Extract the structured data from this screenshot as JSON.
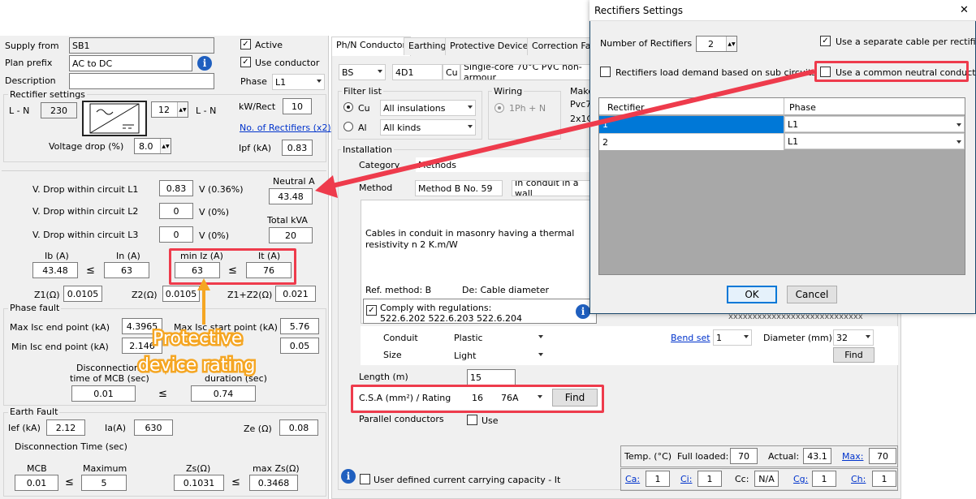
{
  "left": {
    "supply_from_label": "Supply from",
    "supply_from": "SB1",
    "plan_prefix_label": "Plan prefix",
    "plan_prefix": "AC to DC",
    "description_label": "Description",
    "description": "",
    "active_label": "Active",
    "use_conductor_label": "Use conductor",
    "phase_label": "Phase",
    "phase": "L1",
    "rect_group": "Rectifier settings",
    "ln_label": "L - N",
    "ln_value": "230",
    "ln_out_label": "L - N",
    "rect_count": "12",
    "kw_rect_label": "kW/Rect",
    "kw_rect": "10",
    "num_rect_link": "No. of Rectifiers (x2)",
    "vdrop_label": "Voltage drop (%)",
    "vdrop": "8.0",
    "ipf_label": "Ipf (kA)",
    "ipf": "0.83",
    "vdl1_label": "V. Drop within circuit L1",
    "vdl1": "0.83",
    "vdl1_unit": "V (0.36%)",
    "vdl2_label": "V. Drop within circuit L2",
    "vdl2": "0",
    "vdl2_unit": "V (0%)",
    "vdl3_label": "V. Drop within circuit L3",
    "vdl3": "0",
    "vdl3_unit": "V (0%)",
    "neutral_label": "Neutral A",
    "neutral": "43.48",
    "total_kva_label": "Total kVA",
    "total_kva": "20",
    "ib_label": "Ib (A)",
    "ib": "43.48",
    "in_label": "In (A)",
    "in": "63",
    "miniz_label": "min Iz (A)",
    "miniz": "63",
    "it_label": "It (A)",
    "it": "76",
    "z1_label": "Z1(Ω)",
    "z1": "0.0105",
    "z2_label": "Z2(Ω)",
    "z2": "0.0105",
    "z12_label": "Z1+Z2(Ω)",
    "z12": "0.021",
    "phase_fault": "Phase fault",
    "max_isc_label": "Max Isc end point (kA)",
    "max_isc": "4.3965",
    "max_isc_start_label": "Max Isc start point (kA)",
    "max_isc_start": "5.76",
    "min_isc_label": "Min Isc end point (kA)",
    "min_isc": "2.146",
    "min_isc_start": "0.05",
    "disc_label1": "Disconnection",
    "disc_label2": "time of MCB (sec)",
    "disc_mcb": "0.01",
    "duration_label": "duration (sec)",
    "duration": "0.74",
    "earth_fault": "Earth Fault",
    "ief_label": "Ief (kA)",
    "ief": "2.12",
    "ia_label": "Ia(A)",
    "ia": "630",
    "ze_label": "Ze (Ω)",
    "ze": "0.08",
    "disc_time_label": "Disconnection Time (sec)",
    "mcb_label": "MCB",
    "mcb": "0.01",
    "maximum_label": "Maximum",
    "maximum": "5",
    "zs_label": "Zs(Ω)",
    "zs": "0.1031",
    "maxzs_label": "max Zs(Ω)",
    "maxzs": "0.3468",
    "le": "≤"
  },
  "annotation": {
    "line1": "Protective",
    "line2": "device rating"
  },
  "tabs": [
    "Ph/N Conductor",
    "Earthing",
    "Protective Devices",
    "Correction Fact"
  ],
  "center": {
    "std": "BS",
    "code": "4D1",
    "mat": "Cu",
    "cable": "Single-core 70°C PVC non-armour",
    "filter": "Filter list",
    "cu": "Cu",
    "al": "Al",
    "ins": "All insulations",
    "kinds": "All kinds",
    "wiring": "Wiring",
    "wiring_val": "1Ph + N",
    "make": "Make",
    "make1": "Pvc7",
    "make2": "2x1C",
    "installation": "Installation",
    "category_label": "Category",
    "category": "Methods",
    "method_label": "Method",
    "method": "Method B No. 59",
    "method_desc": "In conduit in a wall",
    "desc": "Cables in conduit in masonry having a thermal resistivity n 2 K.m/W",
    "ref": "Ref. method: B",
    "de": "De: Cable diameter",
    "comply": "Comply with regulations:",
    "regs": "522.6.202 522.6.203 522.6.204",
    "xs": "xxxxxxxxxxxxxxxxxxxxxxxxxxxx",
    "conduit_label": "Conduit",
    "conduit": "Plastic",
    "size_label": "Size",
    "size": "Light",
    "bend_label": "Bend set",
    "bend": "1",
    "diam_label": "Diameter (mm)",
    "diam": "32",
    "find": "Find",
    "length_label": "Length (m)",
    "length": "15",
    "csa_label": "C.S.A (mm²) / Rating",
    "csa": "16",
    "rating": "76A",
    "parallel_label": "Parallel conductors",
    "use": "Use",
    "temp_label": "Temp. (°C)",
    "full_label": "Full loaded:",
    "full": "70",
    "actual_label": "Actual:",
    "actual": "43.1",
    "max_label": "Max:",
    "max": "70",
    "ca_label": "Ca:",
    "ca": "1",
    "ci_label": "Ci:",
    "ci": "1",
    "cc_label": "Cc:",
    "cc": "N/A",
    "cg_label": "Cg:",
    "cg": "1",
    "ch_label": "Ch:",
    "ch": "1",
    "user_defined": "User defined current carrying capacity - It"
  },
  "dialog": {
    "title": "Rectifiers Settings",
    "close": "✕",
    "num_label": "Number of Rectifiers",
    "num": "2",
    "sep_cable": "Use a separate cable per rectifier",
    "load_demand": "Rectifiers load demand based on sub circuits",
    "common_neutral": "Use a common neutral conductor",
    "col_rect": "Rectifier",
    "col_phase": "Phase",
    "rows": [
      {
        "r": "1",
        "p": "L1"
      },
      {
        "r": "2",
        "p": "L1"
      }
    ],
    "ok": "OK",
    "cancel": "Cancel"
  }
}
